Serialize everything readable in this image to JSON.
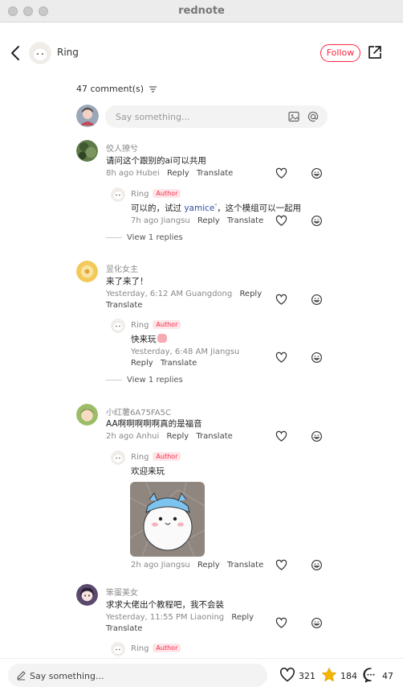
{
  "window": {
    "title": "rednote"
  },
  "header": {
    "author_name": "Ring",
    "follow_label": "Follow"
  },
  "comments_header": {
    "count_label": "47 comment(s)"
  },
  "composer": {
    "placeholder": "Say something..."
  },
  "comments": [
    {
      "name": "佼人撩兮",
      "text": "请问这个跟别的ai可以共用",
      "meta": "8h ago Hubei",
      "reply": "Reply",
      "translate": "Translate",
      "sub": {
        "name": "Ring",
        "badge": "Author",
        "text_before": "可以的，试过 ",
        "mention": "yamice",
        "text_after": "，这个模组可以一起用",
        "meta": "7h ago Jiangsu",
        "reply": "Reply",
        "translate": "Translate"
      },
      "view_replies": "View 1 replies"
    },
    {
      "name": "昱化女主",
      "text": "来了来了！",
      "meta": "Yesterday, 6:12 AM Guangdong",
      "reply": "Reply",
      "translate": "Translate",
      "sub": {
        "name": "Ring",
        "badge": "Author",
        "text": "快来玩",
        "meta": "Yesterday, 6:48 AM Jiangsu",
        "reply": "Reply",
        "translate": "Translate"
      },
      "view_replies": "View 1 replies"
    },
    {
      "name": "小红薯6A75FA5C",
      "text": "AA啊啊啊啊啊真的是福音",
      "meta": "2h ago Anhui",
      "reply": "Reply",
      "translate": "Translate",
      "sub": {
        "name": "Ring",
        "badge": "Author",
        "text": "欢迎来玩",
        "meta": "2h ago Jiangsu",
        "reply": "Reply",
        "translate": "Translate"
      }
    },
    {
      "name": "笨蛋美女",
      "text": "求求大佬出个教程吧，我不会装",
      "meta": "Yesterday, 11:55 PM Liaoning",
      "reply": "Reply",
      "translate": "Translate",
      "sub": {
        "name": "Ring",
        "badge": "Author"
      }
    }
  ],
  "bottom_bar": {
    "placeholder": "Say something...",
    "likes": "321",
    "favorites": "184",
    "comments": "47"
  },
  "colors": {
    "brand": "#ff2442",
    "star": "#f5b400",
    "mention": "#2b4f9e"
  }
}
